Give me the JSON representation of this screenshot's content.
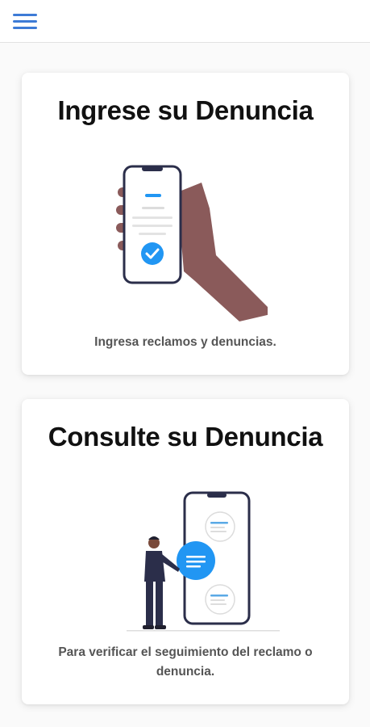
{
  "header": {
    "menu_icon": "hamburger-menu-icon",
    "accent_color": "#3d7bd6"
  },
  "cards": [
    {
      "title": "Ingrese su Denuncia",
      "description": "Ingresa reclamos y denuncias.",
      "illustration": "hand-holding-phone-checkmark-illustration"
    },
    {
      "title": "Consulte su Denuncia",
      "description": "Para verificar el seguimiento del reclamo o denuncia.",
      "illustration": "person-with-phone-chat-bubbles-illustration"
    }
  ],
  "colors": {
    "accent_blue": "#2196f3",
    "hand": "#8a5a5a",
    "phone_outline": "#2b2e4a"
  }
}
